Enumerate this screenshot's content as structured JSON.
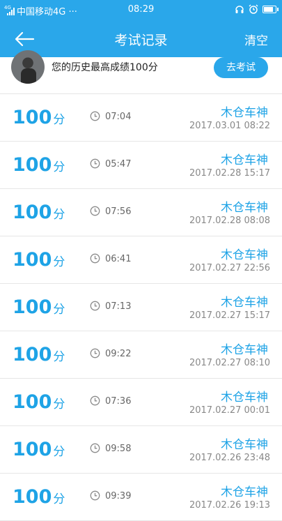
{
  "status_bar": {
    "network_tag": "4G",
    "carrier": "中国移动4G ···",
    "time": "08:29"
  },
  "nav": {
    "title": "考试记录",
    "clear_label": "清空"
  },
  "profile": {
    "best_text": "您的历史最高成绩100分",
    "go_exam_label": "去考试"
  },
  "records": [
    {
      "score": "100",
      "unit": "分",
      "duration": "07:04",
      "user": "木仓车神",
      "date": "2017.03.01  08:22"
    },
    {
      "score": "100",
      "unit": "分",
      "duration": "05:47",
      "user": "木仓车神",
      "date": "2017.02.28  15:17"
    },
    {
      "score": "100",
      "unit": "分",
      "duration": "07:56",
      "user": "木仓车神",
      "date": "2017.02.28  08:08"
    },
    {
      "score": "100",
      "unit": "分",
      "duration": "06:41",
      "user": "木仓车神",
      "date": "2017.02.27  22:56"
    },
    {
      "score": "100",
      "unit": "分",
      "duration": "07:13",
      "user": "木仓车神",
      "date": "2017.02.27  15:17"
    },
    {
      "score": "100",
      "unit": "分",
      "duration": "09:22",
      "user": "木仓车神",
      "date": "2017.02.27  08:10"
    },
    {
      "score": "100",
      "unit": "分",
      "duration": "07:36",
      "user": "木仓车神",
      "date": "2017.02.27  00:01"
    },
    {
      "score": "100",
      "unit": "分",
      "duration": "09:58",
      "user": "木仓车神",
      "date": "2017.02.26  23:48"
    },
    {
      "score": "100",
      "unit": "分",
      "duration": "09:39",
      "user": "木仓车神",
      "date": "2017.02.26  19:13"
    }
  ],
  "colors": {
    "brand": "#2aa7ea",
    "accent_text": "#1ea3e6"
  },
  "icons": {
    "back": "arrow-left-icon",
    "duration": "clock-icon"
  }
}
